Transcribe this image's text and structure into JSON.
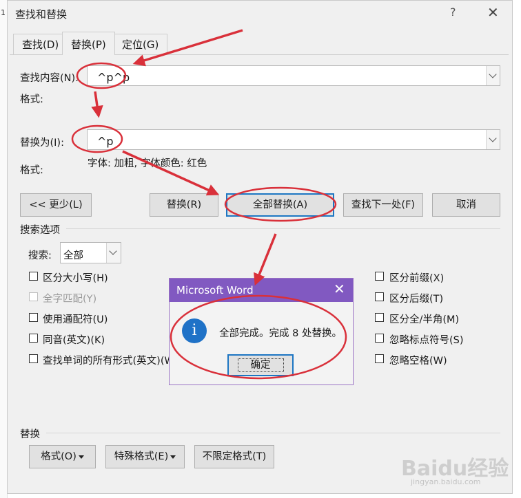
{
  "window": {
    "title": "查找和替换",
    "help": "?",
    "close": "✕",
    "edge_text": "1"
  },
  "tabs": [
    {
      "label": "查找(D)"
    },
    {
      "label": "替换(P)"
    },
    {
      "label": "定位(G)"
    }
  ],
  "find": {
    "label": "查找内容(N):",
    "value": "^p^p",
    "format_label": "格式:"
  },
  "replace": {
    "label": "替换为(I):",
    "value": "^p",
    "format_label": "格式:",
    "format_value": "字体: 加粗, 字体颜色: 红色"
  },
  "buttons": {
    "less": "<< 更少(L)",
    "replace": "替换(R)",
    "replace_all": "全部替换(A)",
    "find_next": "查找下一处(F)",
    "cancel": "取消"
  },
  "search_options": {
    "heading": "搜索选项",
    "search_label": "搜索:",
    "search_value": "全部",
    "left_options": [
      {
        "label": "区分大小写(H)",
        "checked": false,
        "disabled": false
      },
      {
        "label": "全字匹配(Y)",
        "checked": false,
        "disabled": true
      },
      {
        "label": "使用通配符(U)",
        "checked": false,
        "disabled": false
      },
      {
        "label": "同音(英文)(K)",
        "checked": false,
        "disabled": false
      },
      {
        "label": "查找单词的所有形式(英文)(W)",
        "checked": false,
        "disabled": false
      }
    ],
    "right_options": [
      {
        "label": "区分前缀(X)",
        "checked": false
      },
      {
        "label": "区分后缀(T)",
        "checked": false
      },
      {
        "label": "区分全/半角(M)",
        "checked": false
      },
      {
        "label": "忽略标点符号(S)",
        "checked": false
      },
      {
        "label": "忽略空格(W)",
        "checked": false
      }
    ]
  },
  "replace_section": {
    "heading": "替换",
    "format_button": "格式(O)",
    "special_button": "特殊格式(E)",
    "no_format_button": "不限定格式(T)"
  },
  "message_box": {
    "title": "Microsoft Word",
    "close": "✕",
    "icon": "i",
    "text": "全部完成。完成 8 处替换。",
    "ok": "确定"
  },
  "colors": {
    "accent_purple": "#8159c1",
    "annotation_red": "#d9303a",
    "default_button_border": "#1d76c3",
    "info_icon": "#1f72c7"
  },
  "icons": [
    "help-icon",
    "close-icon",
    "chevron-down-icon",
    "info-icon",
    "dropdown-arrow-icon"
  ],
  "watermark": {
    "brand": "Baidu经验",
    "url": "jingyan.baidu.com"
  }
}
